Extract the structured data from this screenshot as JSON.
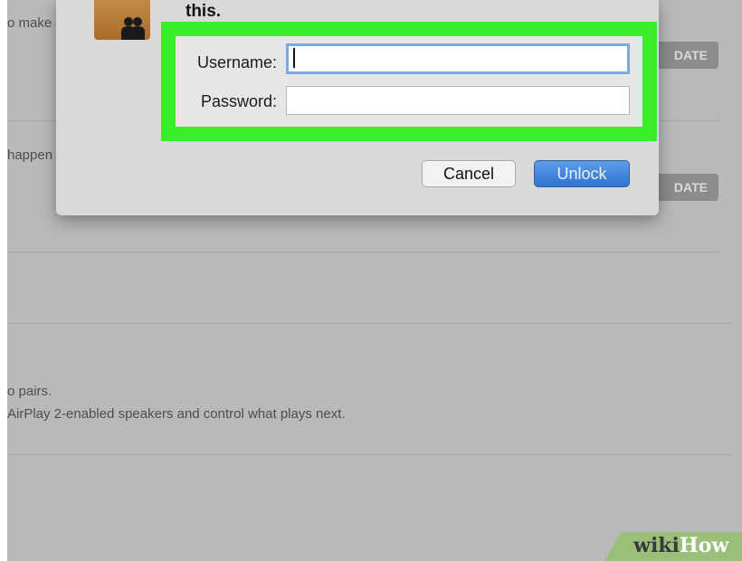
{
  "background": {
    "items": [
      {
        "text": "o make"
      },
      {
        "text": "happen"
      },
      {
        "text": "o pairs."
      },
      {
        "text": "AirPlay 2-enabled speakers and control what plays next."
      }
    ],
    "update_buttons": [
      "DATE",
      "DATE"
    ]
  },
  "dialog": {
    "message": "this.",
    "avatar_icon": "users-icon",
    "username_label": "Username:",
    "username_value": "",
    "password_label": "Password:",
    "password_value": "",
    "cancel_label": "Cancel",
    "unlock_label": "Unlock"
  },
  "watermark": {
    "part1": "wiki",
    "part2": "How"
  },
  "colors": {
    "highlight": "#3bee2a",
    "primary_button": "#2f74d0",
    "watermark_badge": "#9abf78"
  }
}
